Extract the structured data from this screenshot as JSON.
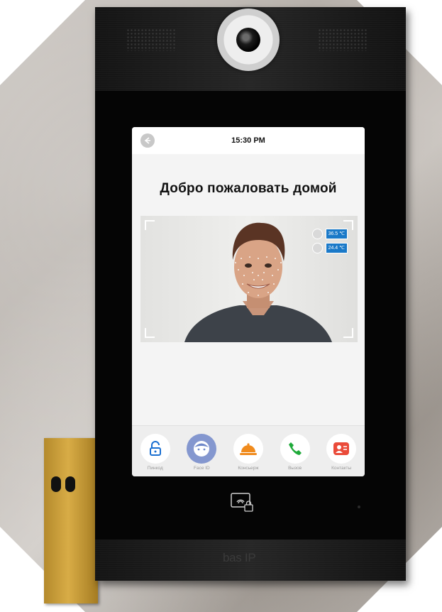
{
  "screen": {
    "time": "15:30 PM",
    "welcome": "Добро пожаловать домой",
    "readings": [
      {
        "icon": "person-icon",
        "value": "36.5 ℃"
      },
      {
        "icon": "thermometer-icon",
        "value": "24.4 ℃"
      }
    ],
    "dock": [
      {
        "icon": "lock-icon",
        "label": "Пинкод",
        "color": "#1a6fd1"
      },
      {
        "icon": "face-id-icon",
        "label": "Face ID",
        "color": "#6f88c9"
      },
      {
        "icon": "concierge-bell-icon",
        "label": "Консьерж",
        "color": "#f08b1d"
      },
      {
        "icon": "phone-icon",
        "label": "Вызов",
        "color": "#1faa3a"
      },
      {
        "icon": "contacts-icon",
        "label": "Контакты",
        "color": "#ea4b3a"
      }
    ]
  },
  "device": {
    "brand": "bas IP",
    "accent": "#1a79c8"
  }
}
